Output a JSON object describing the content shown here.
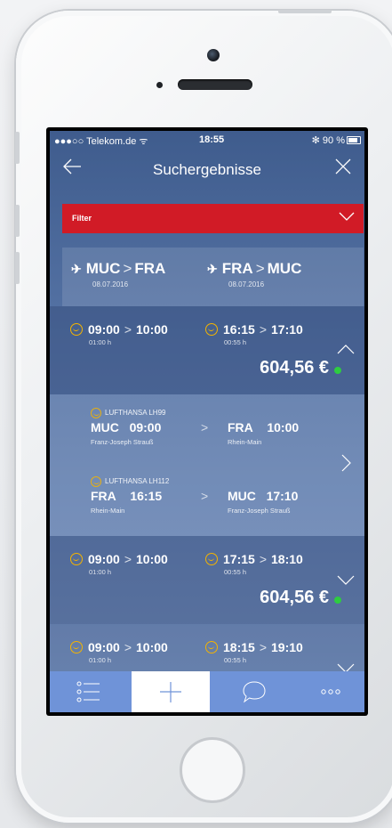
{
  "status_bar": {
    "carrier": "●●●○○ Telekom.de ᯤ",
    "time": "18:55",
    "right": "✻ 90 %"
  },
  "nav": {
    "title": "Suchergebnisse"
  },
  "filter": {
    "label": "Filter"
  },
  "route": {
    "outbound": {
      "from": "MUC",
      "to": "FRA",
      "date": "08.07.2016"
    },
    "inbound": {
      "from": "FRA",
      "to": "MUC",
      "date": "08.07.2016"
    }
  },
  "results": [
    {
      "out": {
        "dep": "09:00",
        "arr": "10:00",
        "duration": "01:00 h"
      },
      "ret": {
        "dep": "16:15",
        "arr": "17:10",
        "duration": "00:55 h"
      },
      "price": "604,56 €",
      "expanded": true
    },
    {
      "out": {
        "dep": "09:00",
        "arr": "10:00",
        "duration": "01:00 h"
      },
      "ret": {
        "dep": "17:15",
        "arr": "18:10",
        "duration": "00:55 h"
      },
      "price": "604,56 €",
      "expanded": false
    },
    {
      "out": {
        "dep": "09:00",
        "arr": "10:00",
        "duration": "01:00 h"
      },
      "ret": {
        "dep": "18:15",
        "arr": "19:10",
        "duration": "00:55 h"
      },
      "price": "",
      "expanded": false
    }
  ],
  "detail": {
    "legs": [
      {
        "airline": "LUFTHANSA LH99",
        "from_code": "MUC",
        "from_time": "09:00",
        "from_airport": "Franz-Joseph Strauß",
        "to_code": "FRA",
        "to_time": "10:00",
        "to_airport": "Rhein-Main"
      },
      {
        "airline": "LUFTHANSA LH112",
        "from_code": "FRA",
        "from_time": "16:15",
        "from_airport": "Rhein-Main",
        "to_code": "MUC",
        "to_time": "17:10",
        "to_airport": "Franz-Joseph Strauß"
      }
    ]
  },
  "tabbar": {
    "items": [
      {
        "icon": "list-icon",
        "active": false
      },
      {
        "icon": "plus-icon",
        "active": true
      },
      {
        "icon": "chat-bubble-icon",
        "active": false
      },
      {
        "icon": "more-icon",
        "active": false
      }
    ]
  },
  "colors": {
    "accent_red": "#d11b26",
    "lufthansa_yellow": "#f4b400",
    "status_green": "#2ecc40",
    "tabbar": "#6f93d8"
  }
}
